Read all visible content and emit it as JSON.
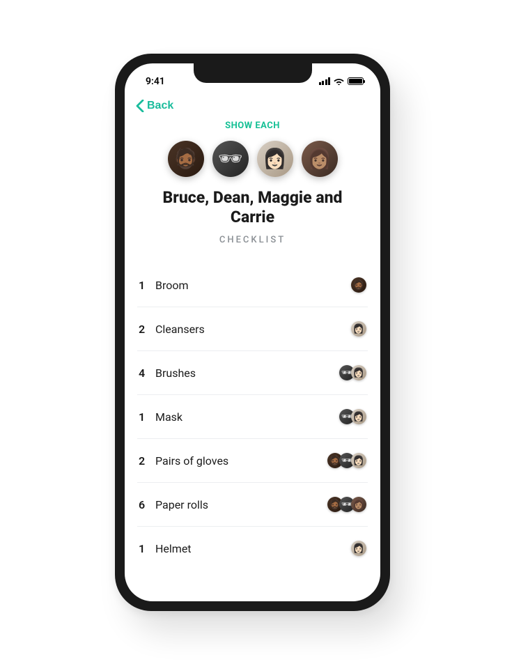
{
  "statusBar": {
    "time": "9:41"
  },
  "nav": {
    "backLabel": "Back"
  },
  "header": {
    "showEach": "SHOW EACH",
    "namesLine": "Bruce, Dean, Maggie and Carrie",
    "subtitle": "CHECKLIST",
    "people": [
      "bruce",
      "dean",
      "maggie",
      "carrie"
    ]
  },
  "checklist": [
    {
      "qty": "1",
      "name": "Broom",
      "owners": [
        "bruce"
      ]
    },
    {
      "qty": "2",
      "name": "Cleansers",
      "owners": [
        "maggie"
      ]
    },
    {
      "qty": "4",
      "name": "Brushes",
      "owners": [
        "dean",
        "maggie"
      ]
    },
    {
      "qty": "1",
      "name": "Mask",
      "owners": [
        "dean",
        "maggie"
      ]
    },
    {
      "qty": "2",
      "name": "Pairs of gloves",
      "owners": [
        "bruce",
        "dean",
        "maggie"
      ]
    },
    {
      "qty": "6",
      "name": "Paper rolls",
      "owners": [
        "bruce",
        "dean",
        "carrie"
      ]
    },
    {
      "qty": "1",
      "name": "Helmet",
      "owners": [
        "maggie"
      ]
    }
  ],
  "avatarGlyph": {
    "bruce": "🧔🏾",
    "dean": "🕶",
    "maggie": "👩🏻",
    "carrie": "👩🏽"
  }
}
